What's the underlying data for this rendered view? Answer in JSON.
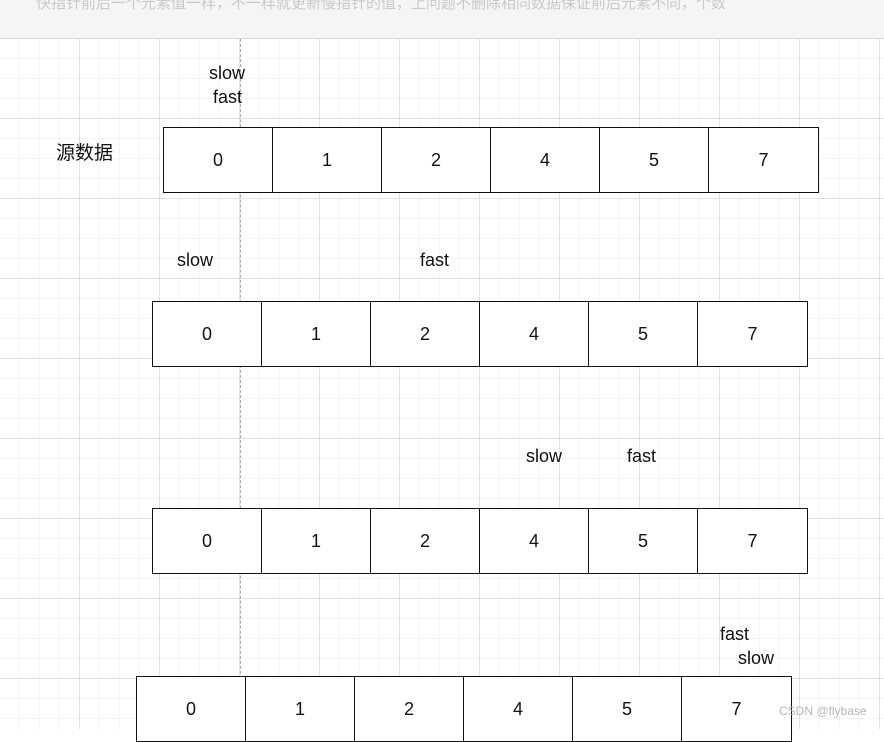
{
  "top_strip": {
    "text": "快指针前后一个元素值一样，不一样就更新慢指针的值，上问题不删除相同数据保证前后元素不同，个数"
  },
  "source_label": "源数据",
  "rows": [
    {
      "cells": [
        "0",
        "1",
        "2",
        "4",
        "5",
        "7"
      ],
      "slow_label": "slow",
      "fast_label": "fast"
    },
    {
      "cells": [
        "0",
        "1",
        "2",
        "4",
        "5",
        "7"
      ],
      "slow_label": "slow",
      "fast_label": "fast"
    },
    {
      "cells": [
        "0",
        "1",
        "2",
        "4",
        "5",
        "7"
      ],
      "slow_label": "slow",
      "fast_label": "fast"
    },
    {
      "cells": [
        "0",
        "1",
        "2",
        "4",
        "5",
        "7"
      ],
      "slow_label": "slow",
      "fast_label": "fast"
    }
  ],
  "watermark": "CSDN @flybase",
  "colors": {
    "stroke": "#111111",
    "grid": "#d2d2d2",
    "guide": "#a8a8a8",
    "background": "#ffffff"
  }
}
